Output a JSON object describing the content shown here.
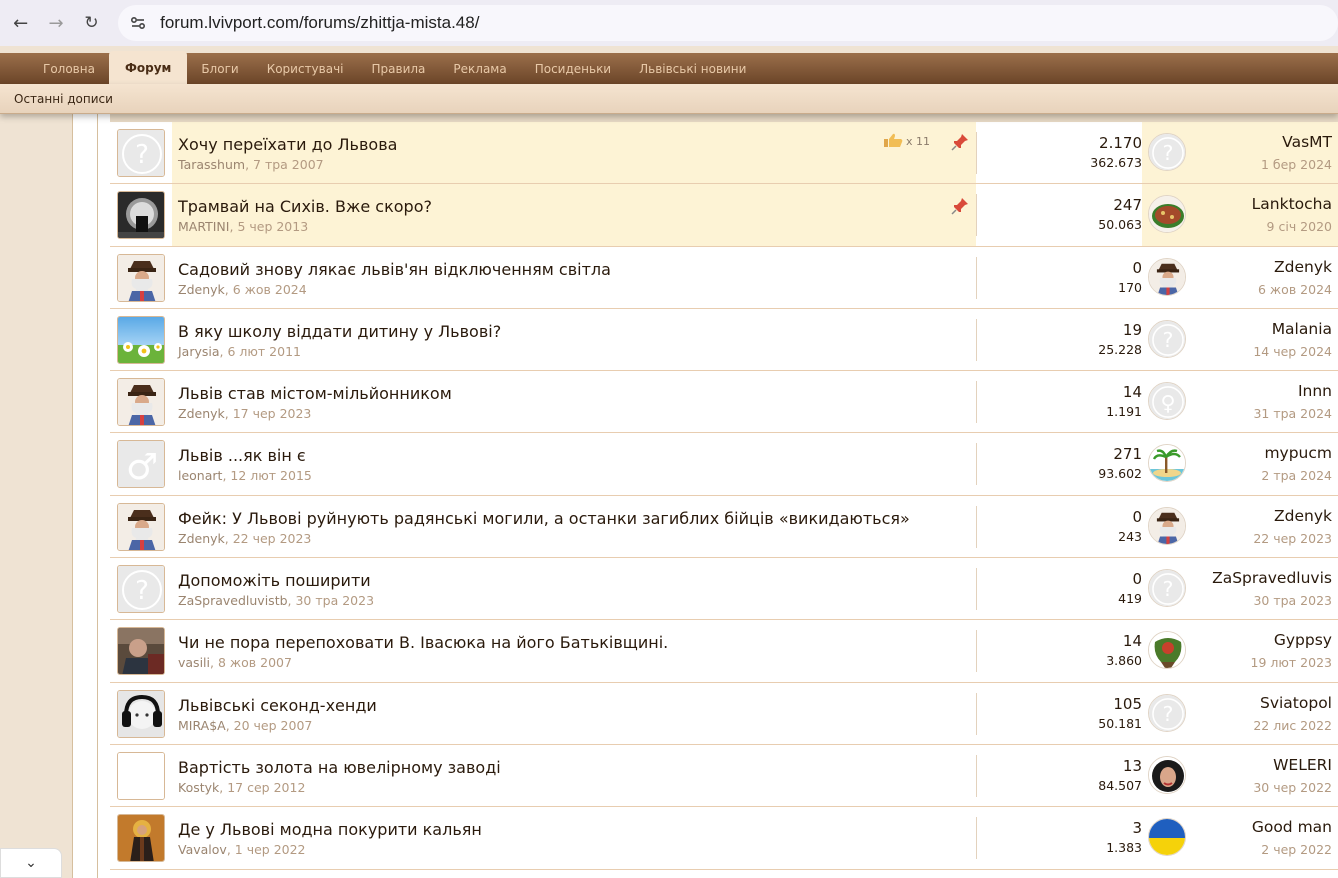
{
  "browser": {
    "back_icon": "←",
    "forward_icon": "→",
    "reload_icon": "↻",
    "url": "forum.lvivport.com/forums/zhittja-mista.48/"
  },
  "nav": {
    "tabs": [
      "Головна",
      "Форум",
      "Блоги",
      "Користувачі",
      "Правила",
      "Реклама",
      "Посиденьки",
      "Львівські новини"
    ],
    "active_tab": "Форум",
    "sub_link": "Останні дописи"
  },
  "colors": {
    "nav_bg": "#7a5232",
    "sticky_bg": "#fdf3d5",
    "meta_text": "#b39a82"
  },
  "threads": [
    {
      "title": "Хочу переїхати до Львова",
      "author": "Tarasshum",
      "date": "7 тра 2007",
      "replies": "2.170",
      "views": "362.673",
      "last_user": "VasMT",
      "last_date": "1 бер 2024",
      "sticky": true,
      "likes": "x 11",
      "avatar": "question",
      "last_avatar": "question"
    },
    {
      "title": "Трамвай на Сихів. Вже скоро?",
      "author": "MARTINI",
      "date": "5 чер 2013",
      "replies": "247",
      "views": "50.063",
      "last_user": "Lanktocha",
      "last_date": "9 січ 2020",
      "sticky": true,
      "avatar": "photo-dark",
      "last_avatar": "pizza"
    },
    {
      "title": "Садовий знову лякає львів'ян відключенням світла",
      "author": "Zdenyk",
      "date": "6 жов 2024",
      "replies": "0",
      "views": "170",
      "last_user": "Zdenyk",
      "last_date": "6 жов 2024",
      "avatar": "man-hat",
      "last_avatar": "man-hat"
    },
    {
      "title": "В яку школу віддати дитину у Львові?",
      "author": "Jarysia",
      "date": "6 лют 2011",
      "replies": "19",
      "views": "25.228",
      "last_user": "Malania",
      "last_date": "14 чер 2024",
      "avatar": "daisies",
      "last_avatar": "question"
    },
    {
      "title": "Львів став містом-мільйонником",
      "author": "Zdenyk",
      "date": "17 чер 2023",
      "replies": "14",
      "views": "1.191",
      "last_user": "Innn",
      "last_date": "31 тра 2024",
      "avatar": "man-hat",
      "last_avatar": "female"
    },
    {
      "title": "Львів ...як він є",
      "author": "leonart",
      "date": "12 лют 2015",
      "replies": "271",
      "views": "93.602",
      "last_user": "mypucm",
      "last_date": "2 тра 2024",
      "avatar": "male",
      "last_avatar": "palm"
    },
    {
      "title": "Фейк: У Львові руйнують радянські могили, а останки загиблих бійців «викидаються»",
      "author": "Zdenyk",
      "date": "22 чер 2023",
      "replies": "0",
      "views": "243",
      "last_user": "Zdenyk",
      "last_date": "22 чер 2023",
      "avatar": "man-hat",
      "last_avatar": "man-hat"
    },
    {
      "title": "Допоможіть поширити",
      "author": "ZaSpravedluvistb",
      "date": "30 тра 2023",
      "replies": "0",
      "views": "419",
      "last_user": "ZaSpravedluvis",
      "last_date": "30 тра 2023",
      "avatar": "question",
      "last_avatar": "question"
    },
    {
      "title": "Чи не пора перепоховати В. Івасюка на його Батьківщині.",
      "author": "vasili",
      "date": "8 жов 2007",
      "replies": "14",
      "views": "3.860",
      "last_user": "Gyppsy",
      "last_date": "19 лют 2023",
      "avatar": "photo-man",
      "last_avatar": "bird"
    },
    {
      "title": "Львівські секонд-хенди",
      "author": "MIRA$A",
      "date": "20 чер 2007",
      "replies": "105",
      "views": "50.181",
      "last_user": "Sviatopol",
      "last_date": "22 лис 2022",
      "avatar": "baby",
      "last_avatar": "question"
    },
    {
      "title": "Вартість золота на ювелірному заводі",
      "author": "Kostyk",
      "date": "17 сер 2012",
      "replies": "13",
      "views": "84.507",
      "last_user": "WELERI",
      "last_date": "30 чер 2022",
      "avatar": "blank",
      "last_avatar": "woman"
    },
    {
      "title": "Де у Львові модна покурити кальян",
      "author": "Vavalov",
      "date": "1 чер 2022",
      "replies": "3",
      "views": "1.383",
      "last_user": "Good man",
      "last_date": "2 чер 2022",
      "avatar": "icon-saint",
      "last_avatar": "ukraine"
    }
  ],
  "footer": {
    "chevron_icon": "⌄"
  }
}
